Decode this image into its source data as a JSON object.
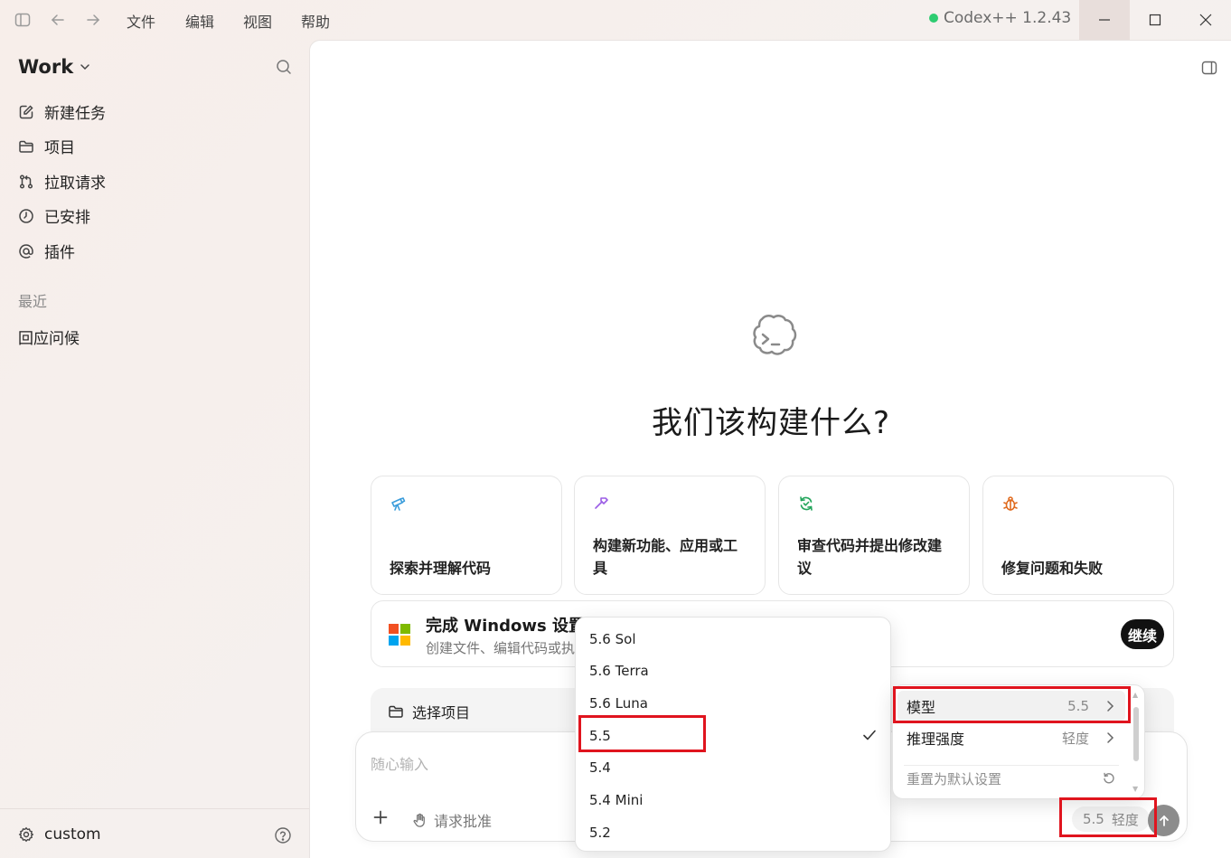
{
  "titlebar": {
    "menus": [
      "文件",
      "编辑",
      "视图",
      "帮助"
    ],
    "app_name": "Codex++ 1.2.43"
  },
  "sidebar": {
    "workspace": "Work",
    "nav": [
      {
        "label": "新建任务",
        "icon": "compose-icon"
      },
      {
        "label": "项目",
        "icon": "folder-icon"
      },
      {
        "label": "拉取请求",
        "icon": "pull-request-icon"
      },
      {
        "label": "已安排",
        "icon": "clock-icon"
      },
      {
        "label": "插件",
        "icon": "at-icon"
      }
    ],
    "recent_label": "最近",
    "recent_items": [
      "回应问候"
    ],
    "footer_user": "custom"
  },
  "main": {
    "hero_title": "我们该构建什么?",
    "cards": [
      {
        "label": "探索并理解代码",
        "icon": "telescope-icon",
        "color": "#3b9ddb"
      },
      {
        "label": "构建新功能、应用或工具",
        "icon": "hammer-icon",
        "color": "#9b5de5"
      },
      {
        "label": "审查代码并提出修改建议",
        "icon": "refresh-check-icon",
        "color": "#22a55b"
      },
      {
        "label": "修复问题和失败",
        "icon": "bug-icon",
        "color": "#e06b1f"
      }
    ],
    "setup_banner": {
      "title": "完成 Windows 设置以继续",
      "subtitle": "创建文件、编辑代码或执",
      "button": "继续"
    },
    "project_bar": {
      "label": "选择项目"
    },
    "composer": {
      "placeholder": "随心输入",
      "approve_label": "请求批准",
      "model_value": "5.5",
      "effort_value": "轻度"
    }
  },
  "model_menu": {
    "options": [
      "5.6 Sol",
      "5.6 Terra",
      "5.6 Luna",
      "5.5",
      "5.4",
      "5.4 Mini",
      "5.2"
    ],
    "selected": "5.5"
  },
  "settings_menu": {
    "model_label": "模型",
    "model_value": "5.5",
    "effort_label": "推理强度",
    "effort_value": "轻度",
    "reset_label": "重置为默认设置"
  },
  "colors": {
    "highlight": "#e0141e",
    "accent_green": "#2ecc71"
  }
}
